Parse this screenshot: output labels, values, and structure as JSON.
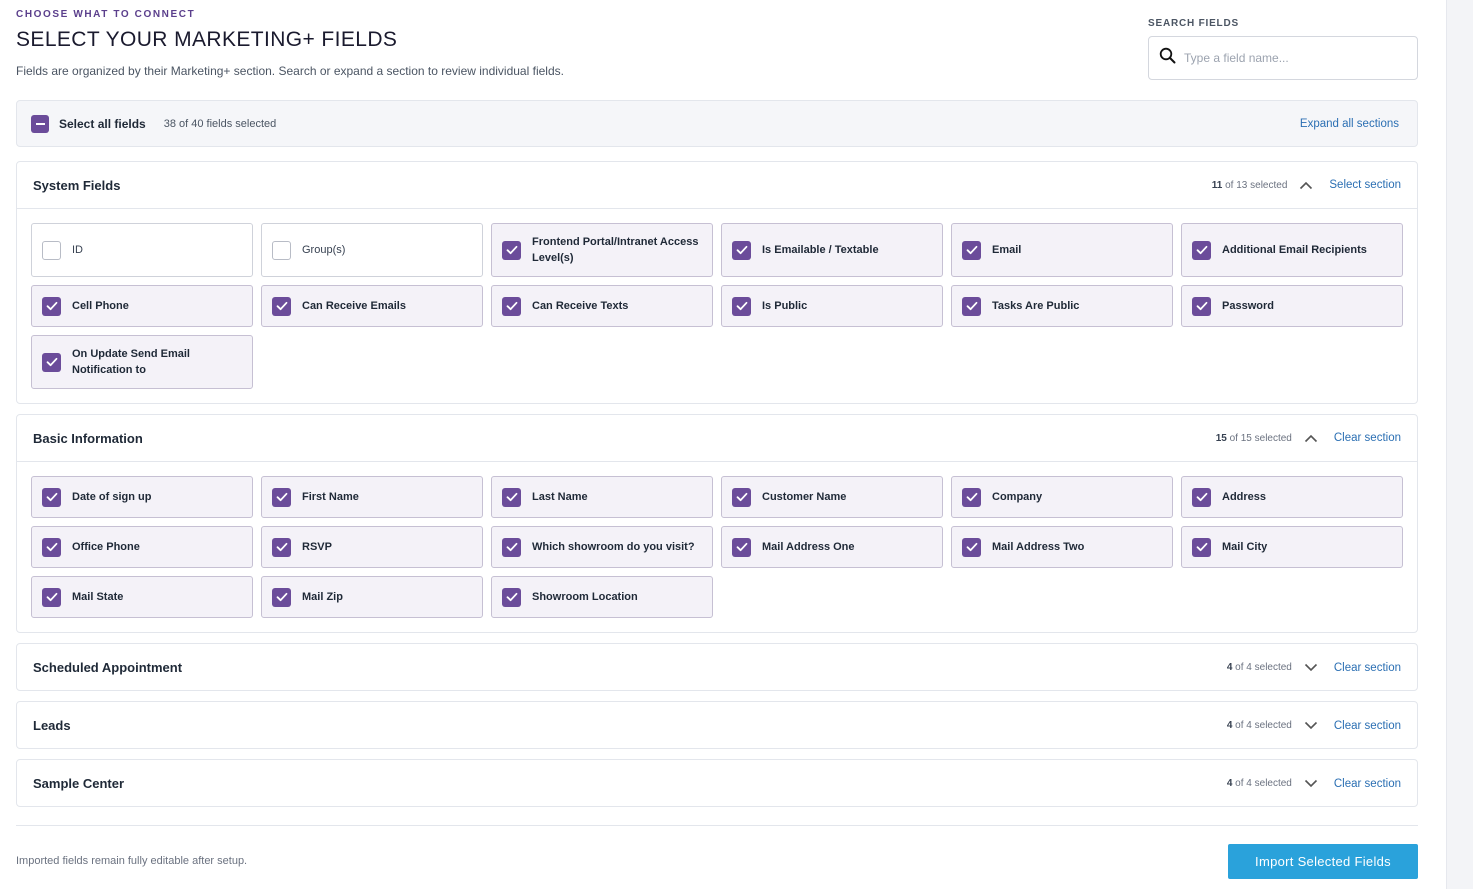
{
  "header": {
    "eyebrow": "CHOOSE WHAT TO CONNECT",
    "title": "SELECT YOUR MARKETING+ FIELDS",
    "subtitle": "Fields are organized by their Marketing+ section. Search or expand a section to review individual fields."
  },
  "search": {
    "label": "SEARCH FIELDS",
    "placeholder": "Type a field name...",
    "value": "",
    "icon": "search-icon"
  },
  "select_all": {
    "label": "Select all fields",
    "count": "38 of 40 fields selected",
    "state": "indeterminate",
    "expand_all_label": "Expand all sections"
  },
  "colors": {
    "accent": "#6b4c9a",
    "link": "#2b6fb3",
    "primary_button": "#2aa2db"
  },
  "sections": [
    {
      "title": "System Fields",
      "selected": "11",
      "of_text": " of 13 selected",
      "expanded": true,
      "action": "Select section",
      "fields": [
        {
          "label": "ID",
          "checked": false
        },
        {
          "label": "Group(s)",
          "checked": false
        },
        {
          "label": "Frontend Portal/Intranet Access Level(s)",
          "checked": true
        },
        {
          "label": "Is Emailable / Textable",
          "checked": true
        },
        {
          "label": "Email",
          "checked": true
        },
        {
          "label": "Additional Email Recipients",
          "checked": true
        },
        {
          "label": "Cell Phone",
          "checked": true
        },
        {
          "label": "Can Receive Emails",
          "checked": true
        },
        {
          "label": "Can Receive Texts",
          "checked": true
        },
        {
          "label": "Is Public",
          "checked": true
        },
        {
          "label": "Tasks Are Public",
          "checked": true
        },
        {
          "label": "Password",
          "checked": true
        },
        {
          "label": "On Update Send Email Notification to",
          "checked": true
        }
      ]
    },
    {
      "title": "Basic Information",
      "selected": "15",
      "of_text": " of 15 selected",
      "expanded": true,
      "action": "Clear section",
      "fields": [
        {
          "label": "Date of sign up",
          "checked": true
        },
        {
          "label": "First Name",
          "checked": true
        },
        {
          "label": "Last Name",
          "checked": true
        },
        {
          "label": "Customer Name",
          "checked": true
        },
        {
          "label": "Company",
          "checked": true
        },
        {
          "label": "Address",
          "checked": true
        },
        {
          "label": "Office Phone",
          "checked": true
        },
        {
          "label": "RSVP",
          "checked": true
        },
        {
          "label": "Which showroom do you visit?",
          "checked": true
        },
        {
          "label": "Mail Address One",
          "checked": true
        },
        {
          "label": "Mail Address Two",
          "checked": true
        },
        {
          "label": "Mail City",
          "checked": true
        },
        {
          "label": "Mail State",
          "checked": true
        },
        {
          "label": "Mail Zip",
          "checked": true
        },
        {
          "label": "Showroom Location",
          "checked": true
        }
      ]
    },
    {
      "title": "Scheduled Appointment",
      "selected": "4",
      "of_text": " of 4 selected",
      "expanded": false,
      "action": "Clear section",
      "fields": []
    },
    {
      "title": "Leads",
      "selected": "4",
      "of_text": " of 4 selected",
      "expanded": false,
      "action": "Clear section",
      "fields": []
    },
    {
      "title": "Sample Center",
      "selected": "4",
      "of_text": " of 4 selected",
      "expanded": false,
      "action": "Clear section",
      "fields": []
    }
  ],
  "footer": {
    "note": "Imported fields remain fully editable after setup.",
    "import_label": "Import Selected Fields"
  }
}
